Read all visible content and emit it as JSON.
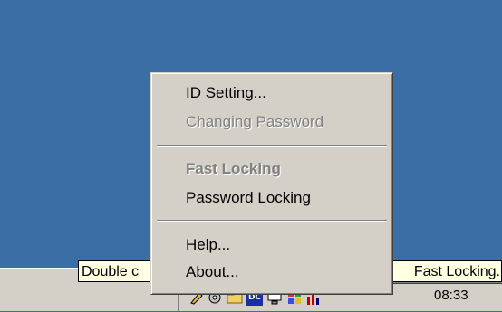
{
  "menu": {
    "items": [
      {
        "label": "ID Setting...",
        "enabled": true,
        "bold": false
      },
      {
        "label": "Changing Password",
        "enabled": false,
        "bold": false
      },
      {
        "label": "Fast Locking",
        "enabled": false,
        "bold": true
      },
      {
        "label": "Password Locking",
        "enabled": true,
        "bold": false
      },
      {
        "label": "Help...",
        "enabled": true,
        "bold": false
      },
      {
        "label": "About...",
        "enabled": true,
        "bold": false
      }
    ]
  },
  "tooltip": {
    "left_text": "Double c",
    "right_text": "Fast Locking."
  },
  "taskbar": {
    "clock": "08:33",
    "tray_icons": [
      "pen-icon",
      "network-icon",
      "folder-icon",
      "dc-icon",
      "monitor-icon",
      "colorful-icon",
      "red-bars-icon"
    ]
  },
  "colors": {
    "desktop": "#3a6ea5",
    "menu_bg": "#d4d0c8",
    "tooltip_bg": "#ffffe1",
    "disabled_text": "#808080"
  }
}
